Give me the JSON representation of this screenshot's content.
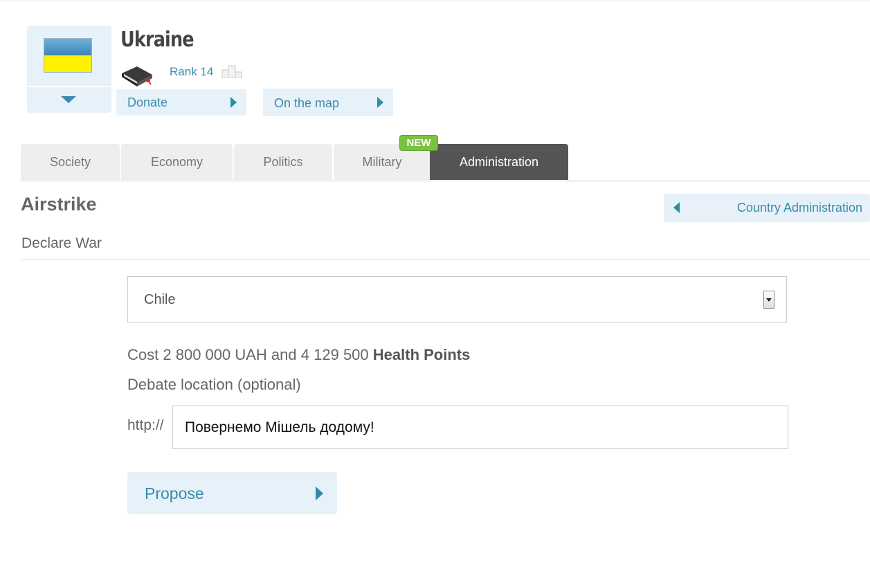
{
  "country": {
    "name": "Ukraine",
    "rank_label": "Rank",
    "rank_value": "14"
  },
  "header_buttons": {
    "donate": "Donate",
    "on_the_map": "On the map"
  },
  "tabs": [
    {
      "label": "Society",
      "active": false
    },
    {
      "label": "Economy",
      "active": false
    },
    {
      "label": "Politics",
      "active": false
    },
    {
      "label": "Military",
      "active": false,
      "badge": "NEW"
    },
    {
      "label": "Administration",
      "active": true
    }
  ],
  "section": {
    "title": "Airstrike",
    "subtitle": "Declare War",
    "back_button": "Country Administration"
  },
  "form": {
    "target_country": "Chile",
    "cost_prefix": "Cost",
    "cost_amount": "2 800 000",
    "cost_currency": "UAH and",
    "cost_health": "4 129 500",
    "cost_health_label": "Health Points",
    "debate_label": "Debate location (optional)",
    "url_prefix": "http://",
    "debate_value": "Повернемо Мішель додому!",
    "submit": "Propose"
  },
  "colors": {
    "accent": "#3a8ca8",
    "button_bg": "#e6f1fa",
    "tab_active": "#555555",
    "badge": "#7cc242",
    "flag_blue": "#3a84bb",
    "flag_yellow": "#fff200"
  },
  "icons": {
    "flag": "ukraine-flag-icon",
    "book": "book-icon",
    "podium": "podium-icon",
    "arrow_down": "chevron-down-icon",
    "arrow_right": "play-right-icon",
    "arrow_left": "play-left-icon"
  }
}
